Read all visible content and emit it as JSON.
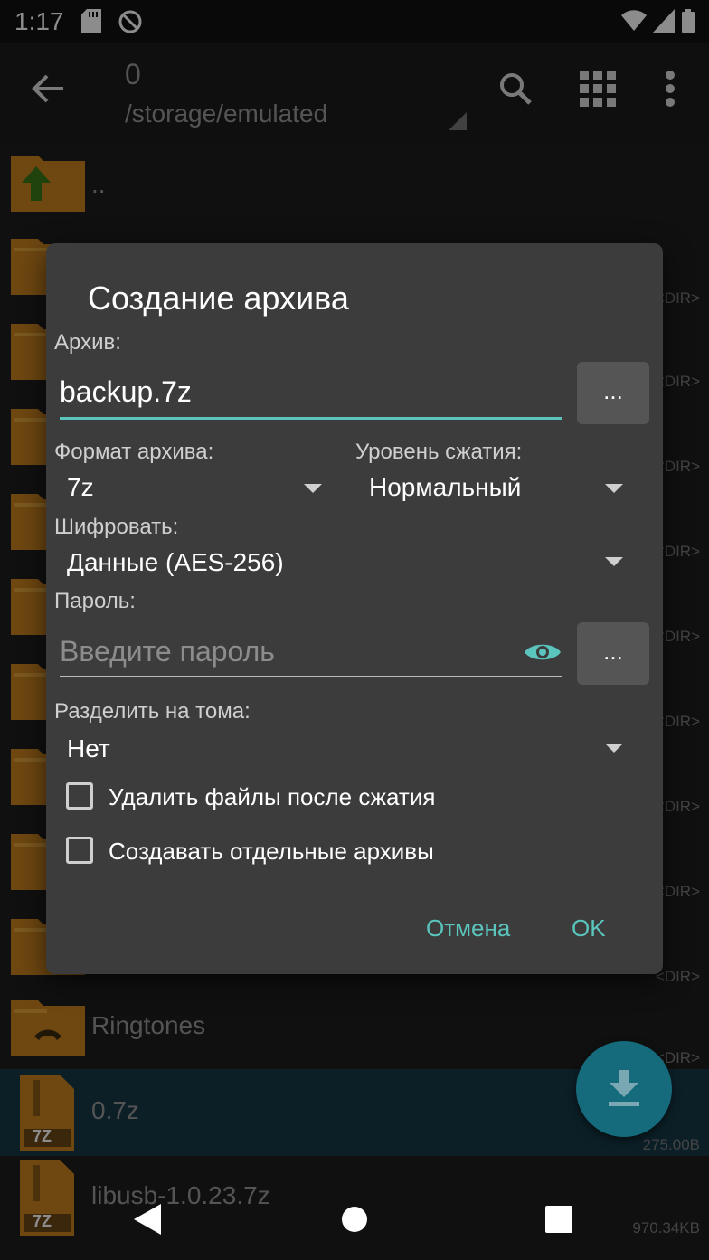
{
  "status": {
    "time": "1:17"
  },
  "appbar": {
    "count": "0",
    "path": "/storage/emulated"
  },
  "list": {
    "parent": "..",
    "dir_label": "<DIR>",
    "ringtones": "Ringtones",
    "file1": {
      "name": "0.7z",
      "size": "275.00B"
    },
    "file2": {
      "name": "libusb-1.0.23.7z",
      "size": "970.34KB"
    },
    "archive_badge": "7Z"
  },
  "dialog": {
    "title": "Создание архива",
    "archive_label": "Архив:",
    "archive_value": "backup.7z",
    "browse": "...",
    "format_label": "Формат архива:",
    "format_value": "7z",
    "level_label": "Уровень сжатия:",
    "level_value": "Нормальный",
    "encrypt_label": "Шифровать:",
    "encrypt_value": "Данные (AES-256)",
    "password_label": "Пароль:",
    "password_placeholder": "Введите пароль",
    "split_label": "Разделить на тома:",
    "split_value": "Нет",
    "checkbox_delete": "Удалить файлы после сжатия",
    "checkbox_separate": "Создавать отдельные архивы",
    "cancel": "Отмена",
    "ok": "OK"
  },
  "colors": {
    "accent": "#5ac4bd",
    "folder": "#c8811f",
    "dialog_bg": "#3c3c3c"
  }
}
